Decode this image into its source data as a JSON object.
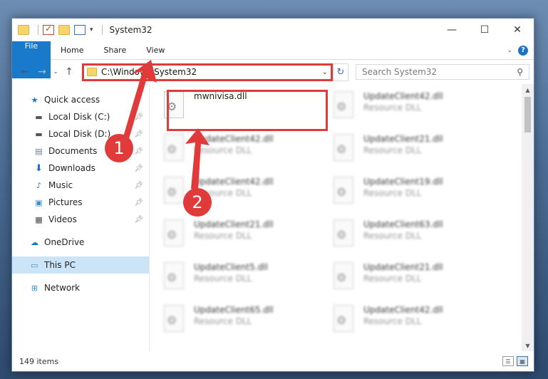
{
  "window": {
    "title": "System32",
    "controls": {
      "minimize": "—",
      "maximize": "☐",
      "close": "✕"
    }
  },
  "ribbon": {
    "tabs": [
      {
        "label": "File"
      },
      {
        "label": "Home"
      },
      {
        "label": "Share"
      },
      {
        "label": "View"
      }
    ],
    "help": "?"
  },
  "address_bar": {
    "path": "C:\\Windows\\System32",
    "search_placeholder": "Search System32"
  },
  "nav": {
    "quick_access": "Quick access",
    "items": [
      {
        "label": "Local Disk (C:)",
        "icon": "drive-icon"
      },
      {
        "label": "Local Disk (D:)",
        "icon": "drive-icon"
      },
      {
        "label": "Documents",
        "icon": "documents-icon"
      },
      {
        "label": "Downloads",
        "icon": "downloads-icon"
      },
      {
        "label": "Music",
        "icon": "music-icon"
      },
      {
        "label": "Pictures",
        "icon": "pictures-icon"
      },
      {
        "label": "Videos",
        "icon": "videos-icon"
      }
    ],
    "onedrive": "OneDrive",
    "this_pc": "This PC",
    "network": "Network"
  },
  "files": [
    {
      "name": "mwnivisa.dll",
      "type": ""
    },
    {
      "name": "UpdateClient42.dll",
      "type": "Resource DLL"
    },
    {
      "name": "UpdateClient42.dll",
      "type": "Resource DLL"
    },
    {
      "name": "UpdateClient21.dll",
      "type": "Resource DLL"
    },
    {
      "name": "UpdateClient42.dll",
      "type": "Resource DLL"
    },
    {
      "name": "UpdateClient19.dll",
      "type": "Resource DLL"
    },
    {
      "name": "UpdateClient21.dll",
      "type": "Resource DLL"
    },
    {
      "name": "UpdateClient63.dll",
      "type": "Resource DLL"
    },
    {
      "name": "UpdateClient5.dll",
      "type": "Resource DLL"
    },
    {
      "name": "UpdateClient21.dll",
      "type": "Resource DLL"
    },
    {
      "name": "UpdateClient65.dll",
      "type": "Resource DLL"
    },
    {
      "name": "UpdateClient42.dll",
      "type": "Resource DLL"
    }
  ],
  "status": {
    "count": "149 items"
  },
  "annotations": {
    "step1": "1",
    "step2": "2"
  },
  "colors": {
    "accent": "#1979ca",
    "highlight": "#e03a3a",
    "selected": "#cce4f7"
  }
}
